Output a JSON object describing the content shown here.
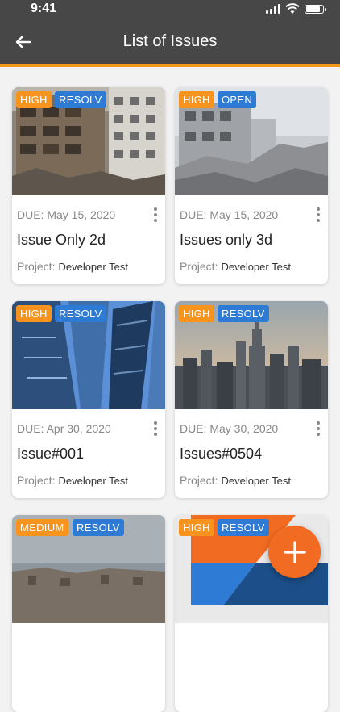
{
  "status_bar": {
    "time": "9:41"
  },
  "header": {
    "title": "List of Issues"
  },
  "cards": [
    {
      "priority": "HIGH",
      "status": "RESOLV",
      "due": "DUE: May 15, 2020",
      "title": "Issue Only 2d",
      "project_label": "Project:",
      "project_name": "Developer Test"
    },
    {
      "priority": "HIGH",
      "status": "OPEN",
      "due": "DUE: May 15, 2020",
      "title": "Issues only 3d",
      "project_label": "Project:",
      "project_name": "Developer Test"
    },
    {
      "priority": "HIGH",
      "status": "RESOLV",
      "due": "DUE: Apr 30, 2020",
      "title": "Issue#001",
      "project_label": "Project:",
      "project_name": "Developer Test"
    },
    {
      "priority": "HIGH",
      "status": "RESOLV",
      "due": "DUE: May 30, 2020",
      "title": "Issues#0504",
      "project_label": "Project:",
      "project_name": "Developer Test"
    },
    {
      "priority": "MEDIUM",
      "status": "RESOLV"
    },
    {
      "priority": "HIGH",
      "status": "RESOLV"
    }
  ],
  "fab": {
    "icon": "plus-icon"
  },
  "colors": {
    "accent": "#f7941d",
    "header_bg": "#474747",
    "status_blue": "#2d7bd5",
    "fab": "#f26b22"
  }
}
